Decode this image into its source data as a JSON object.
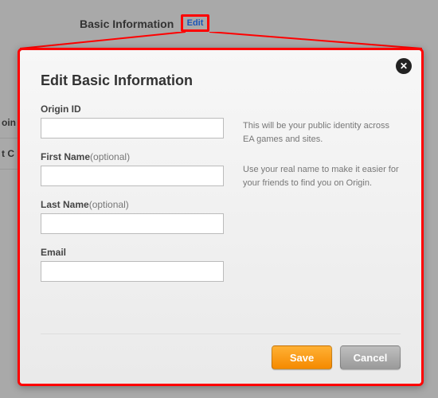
{
  "background": {
    "heading": "Basic Information",
    "edit_link": "Edit",
    "menu_items": [
      "oin",
      "t C"
    ]
  },
  "dialog": {
    "title": "Edit Basic Information",
    "close_label": "✕",
    "fields": {
      "origin_id": {
        "label": "Origin ID",
        "value": ""
      },
      "first_name": {
        "label": "First Name",
        "optional": "(optional)",
        "value": ""
      },
      "last_name": {
        "label": "Last Name",
        "optional": "(optional)",
        "value": ""
      },
      "email": {
        "label": "Email",
        "value": ""
      }
    },
    "help": {
      "identity": "This will be your public identity across EA games and sites.",
      "real_name": "Use your real name to make it easier for your friends to find you on Origin."
    },
    "buttons": {
      "save": "Save",
      "cancel": "Cancel"
    }
  }
}
